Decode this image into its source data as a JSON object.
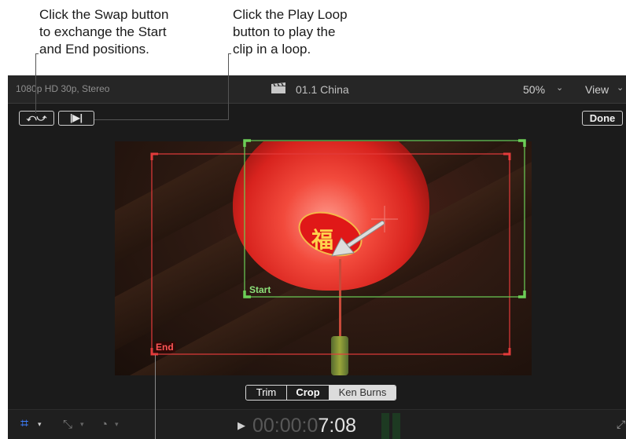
{
  "callouts": {
    "swap": [
      "Click the Swap button",
      "to exchange the Start",
      "and End positions."
    ],
    "play_loop": [
      "Click the Play Loop",
      "button to play the",
      "clip in a loop."
    ]
  },
  "topbar": {
    "format": "1080p HD 30p, Stereo",
    "clip_title": "01.1 China",
    "zoom": "50%",
    "view_menu": "View"
  },
  "buttons": {
    "swap_glyph": "⤺⤻",
    "play_loop_glyph": "|▶|",
    "done": "Done"
  },
  "frames": {
    "start_label": "Start",
    "end_label": "End",
    "start_color": "#6ccf57",
    "end_color": "#e33b3b"
  },
  "video": {
    "charm_glyph": "福"
  },
  "mode_selector": {
    "options": [
      "Trim",
      "Crop",
      "Ken Burns"
    ],
    "selected": "Crop"
  },
  "bottombar": {
    "timecode_dim": "00:00:0",
    "timecode_bright": "7:08",
    "play_glyph": "▶"
  }
}
